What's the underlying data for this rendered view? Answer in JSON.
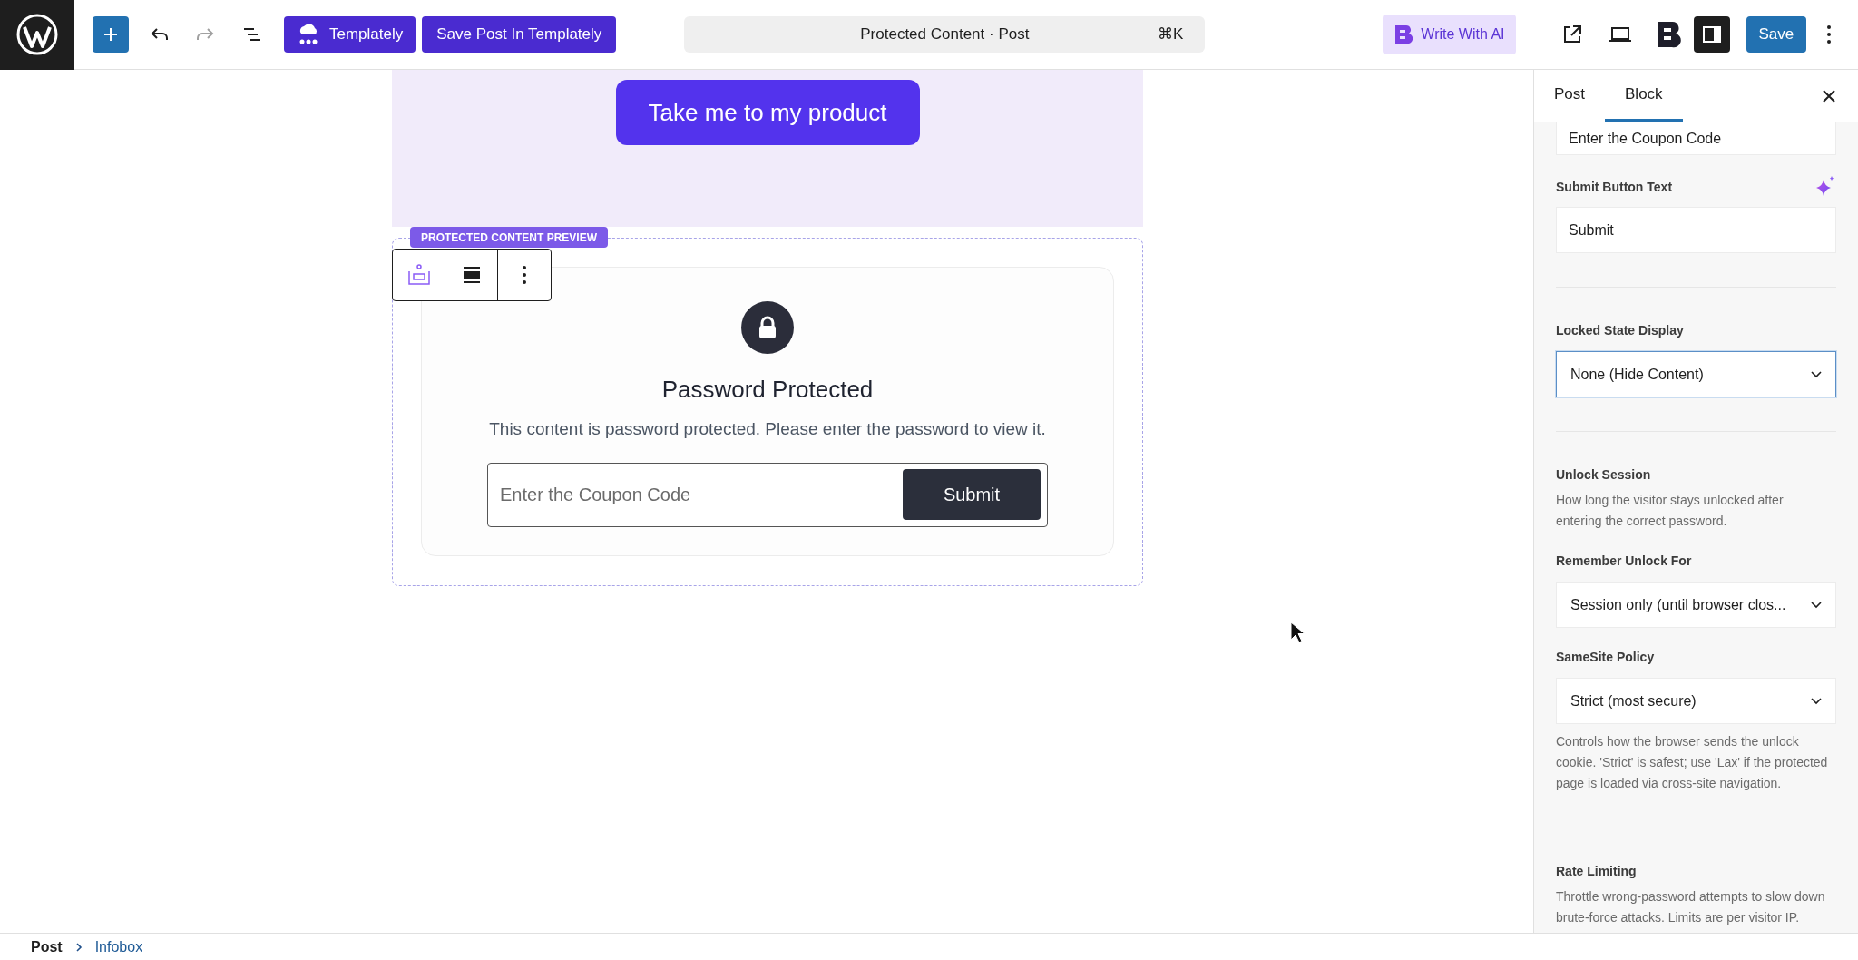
{
  "toolbar": {
    "templately_button": "Templately",
    "save_templately_button": "Save Post In Templately",
    "command_bar": {
      "title": "Protected Content · Post",
      "shortcut": "⌘K"
    },
    "ai_button": "Write With AI",
    "save_button": "Save"
  },
  "canvas": {
    "cta_button": "Take me to my product",
    "preview_label": "PROTECTED CONTENT PREVIEW",
    "card": {
      "title": "Password Protected",
      "message": "This content is password protected. Please enter the password to view it.",
      "input": {
        "placeholder": "Enter the Coupon Code"
      },
      "submit": "Submit"
    }
  },
  "sidebar": {
    "tabs": [
      {
        "label": "Post",
        "selected": false
      },
      {
        "label": "Block",
        "selected": true
      }
    ],
    "panel": [
      {
        "kind": "input",
        "value": "Enter the Coupon Code"
      },
      {
        "kind": "field",
        "label": "Submit Button Text",
        "value": "Submit"
      },
      {
        "kind": "divider"
      },
      {
        "kind": "select",
        "label": "Locked State Display",
        "value": "None (Hide Content)",
        "focused": true
      },
      {
        "kind": "divider"
      },
      {
        "kind": "heading",
        "label": "Unlock Session",
        "help": "How long the visitor stays unlocked after entering the correct password."
      },
      {
        "kind": "select",
        "label": "Remember Unlock For",
        "value": "Session only (until browser clos...",
        "focused": false
      },
      {
        "kind": "select",
        "label": "SameSite Policy",
        "value": "Strict (most secure)",
        "focused": false,
        "help": "Controls how the browser sends the unlock cookie. 'Strict' is safest; use 'Lax' if the protected page is loaded via cross-site navigation."
      },
      {
        "kind": "divider"
      },
      {
        "kind": "heading",
        "label": "Rate Limiting",
        "help": "Throttle wrong-password attempts to slow down brute-force attacks. Limits are per visitor IP."
      }
    ]
  },
  "breadcrumb": [
    {
      "label": "Post",
      "current": false
    },
    {
      "label": "Infobox",
      "current": true
    }
  ]
}
